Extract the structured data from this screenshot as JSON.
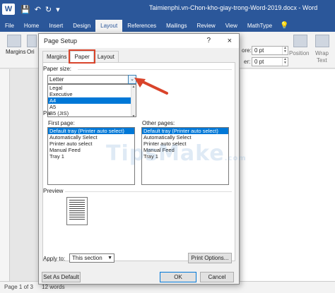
{
  "word": {
    "logo": "W",
    "doc_title": "Taimienphi.vn-Chon-kho-giay-trong-Word-2019.docx - Word",
    "tabs": [
      "File",
      "Home",
      "Insert",
      "Design",
      "Layout",
      "References",
      "Mailings",
      "Review",
      "View",
      "MathType"
    ],
    "active_tab": "Layout",
    "tellme_icon": "lightbulb-icon",
    "ribbon": {
      "margins_label": "Margins",
      "orientation_label": "Ori",
      "before_label": "ore:",
      "after_label": "er:",
      "before_value": "0 pt",
      "after_value": "0 pt",
      "position_label": "Position",
      "wrap_label": "Wrap",
      "wrap_label2": "Text"
    },
    "status": {
      "page": "Page 1 of 3",
      "words": "12 words"
    }
  },
  "dialog": {
    "title": "Page Setup",
    "help": "?",
    "close": "×",
    "tabs": [
      "Margins",
      "Paper",
      "Layout"
    ],
    "active_tab": "Paper",
    "paper_size_label": "Paper size:",
    "paper_size_value": "Letter",
    "paper_size_options": [
      "Legal",
      "Executive",
      "A4",
      "A5",
      "B5 (JIS)"
    ],
    "paper_size_selected": "A4",
    "paper_source_label": "Pa",
    "first_page_label": "First page:",
    "other_pages_label": "Other pages:",
    "first_page_options": [
      "Default tray (Printer auto select)",
      "Automatically Select",
      "Printer auto select",
      "Manual Feed",
      "Tray 1"
    ],
    "other_pages_options": [
      "Default tray (Printer auto select)",
      "Automatically Select",
      "Printer auto select",
      "Manual Feed",
      "Tray 1"
    ],
    "preview_label": "Preview",
    "apply_to_label": "Apply to:",
    "apply_to_value": "This section",
    "print_options_button": "Print Options...",
    "set_default_button": "Set As Default",
    "ok_button": "OK",
    "cancel_button": "Cancel"
  },
  "watermark": "TipsMake",
  "watermark_suffix": ".com",
  "colors": {
    "title_bar": "#2b579a",
    "selection": "#0078d7",
    "highlight": "#d9442b"
  }
}
